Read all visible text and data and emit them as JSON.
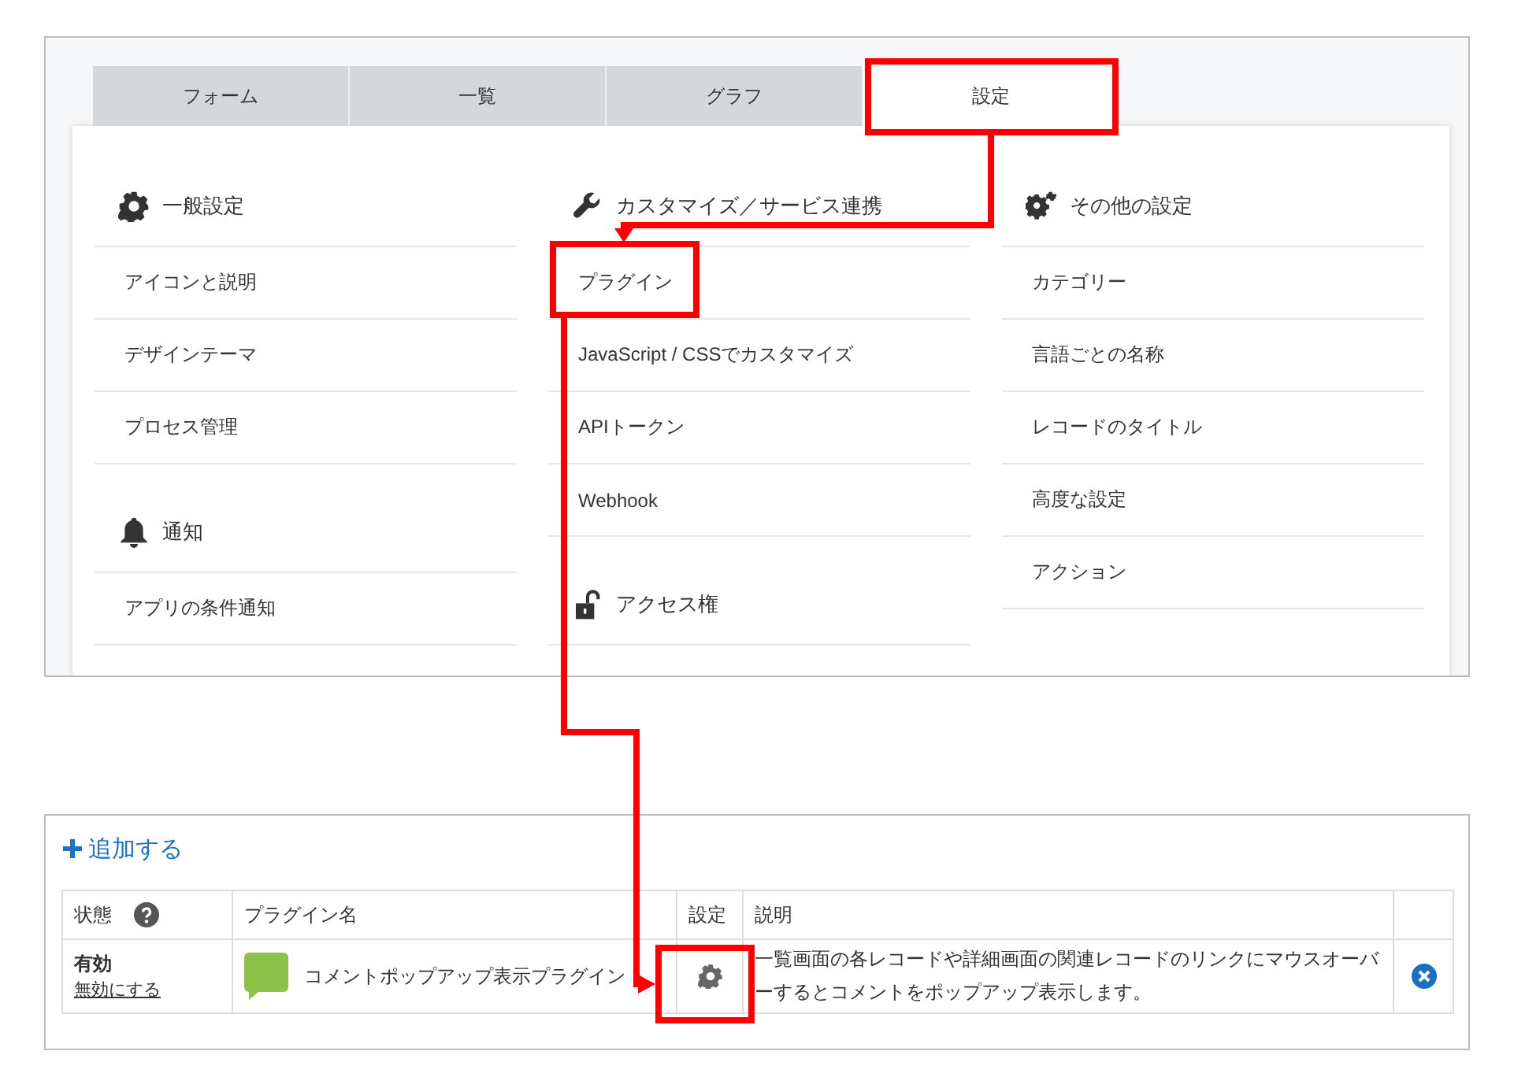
{
  "tabs": [
    {
      "label": "フォーム",
      "selected": false
    },
    {
      "label": "一覧",
      "selected": false
    },
    {
      "label": "グラフ",
      "selected": false
    },
    {
      "label": "設定",
      "selected": true
    }
  ],
  "columns": [
    [
      {
        "title": "一般設定",
        "items": [
          "アイコンと説明",
          "デザインテーマ",
          "プロセス管理"
        ]
      },
      {
        "title": "通知",
        "items": [
          "アプリの条件通知"
        ]
      }
    ],
    [
      {
        "title": "カスタマイズ／サービス連携",
        "items": [
          "プラグイン",
          "JavaScript / CSSでカスタマイズ",
          "APIトークン",
          "Webhook"
        ]
      },
      {
        "title": "アクセス権"
      }
    ],
    [
      {
        "title": "その他の設定",
        "items": [
          "カテゴリー",
          "言語ごとの名称",
          "レコードのタイトル",
          "高度な設定",
          "アクション"
        ]
      }
    ]
  ],
  "plugins": {
    "add_label": "追加する",
    "columns": [
      "状態",
      "プラグイン名",
      "設定",
      "説明"
    ],
    "rows": [
      {
        "status": "有効",
        "toggle_link": "無効にする",
        "name": "コメントポップアップ表示プラグイン",
        "description": "一覧画面の各レコードや詳細画面の関連レコードのリンクにマウスオーバーするとコメントをポップアップ表示します。"
      }
    ]
  }
}
